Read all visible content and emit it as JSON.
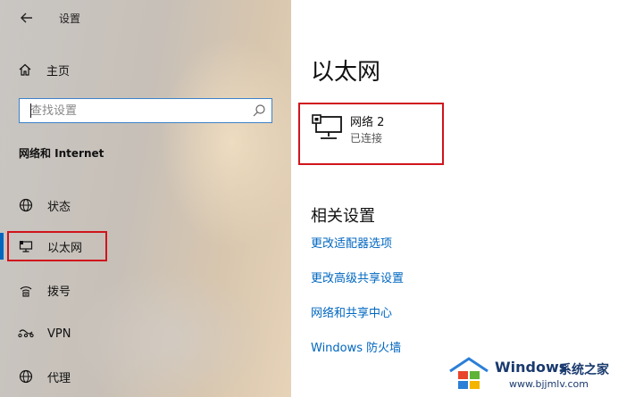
{
  "app": {
    "title": "设置"
  },
  "sidebar": {
    "home_label": "主页",
    "search_placeholder": "查找设置",
    "section_title": "网络和 Internet",
    "items": [
      {
        "label": "状态",
        "icon": "globe-icon"
      },
      {
        "label": "以太网",
        "icon": "monitor-icon",
        "active": true
      },
      {
        "label": "拨号",
        "icon": "dialup-icon"
      },
      {
        "label": "VPN",
        "icon": "vpn-icon"
      },
      {
        "label": "代理",
        "icon": "globe-icon"
      }
    ]
  },
  "main": {
    "title": "以太网",
    "network": {
      "name": "网络 2",
      "status": "已连接"
    },
    "related_title": "相关设置",
    "links": [
      "更改适配器选项",
      "更改高级共享设置",
      "网络和共享中心",
      "Windows 防火墙"
    ]
  },
  "watermark": {
    "brand": "Windows",
    "brand_cn": "系统之家",
    "url": "www.bjjmlv.com"
  },
  "colors": {
    "accent": "#0067c0",
    "highlight": "#d0141c"
  }
}
